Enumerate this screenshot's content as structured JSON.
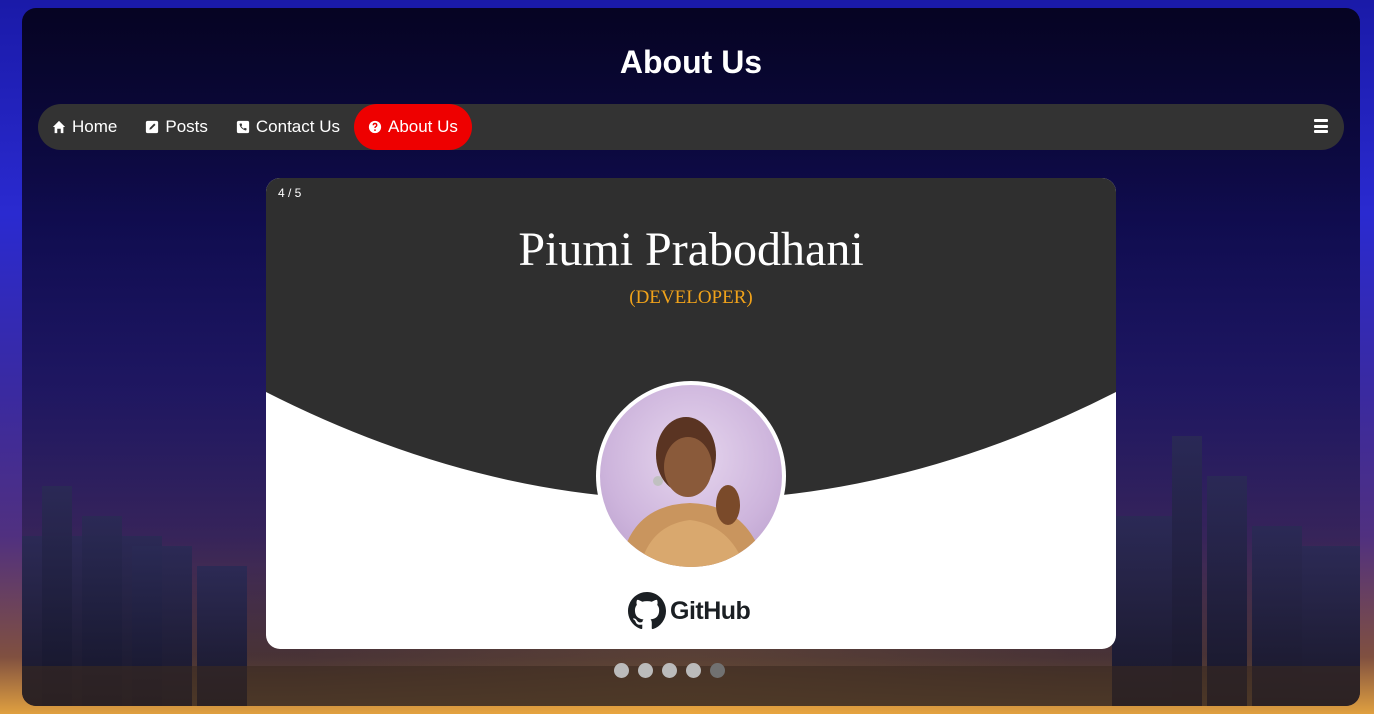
{
  "page": {
    "title": "About Us"
  },
  "nav": {
    "items": [
      {
        "label": "Home",
        "icon": "home-icon"
      },
      {
        "label": "Posts",
        "icon": "edit-icon"
      },
      {
        "label": "Contact Us",
        "icon": "phone-icon"
      },
      {
        "label": "About Us",
        "icon": "question-circle-icon",
        "active": true
      }
    ],
    "menu_icon": "hamburger-menu-icon"
  },
  "slideshow": {
    "counter": "4 / 5",
    "current_index": 4,
    "total": 5,
    "slide": {
      "name": "Piumi Prabodhani",
      "role": "(DEVELOPER)",
      "link_label": "GitHub",
      "link_icon": "github-icon"
    }
  },
  "colors": {
    "active_nav": "#ee0000",
    "navbar": "#333333",
    "role_text": "#f0a21a",
    "slide_dark": "#2f2f2f"
  }
}
